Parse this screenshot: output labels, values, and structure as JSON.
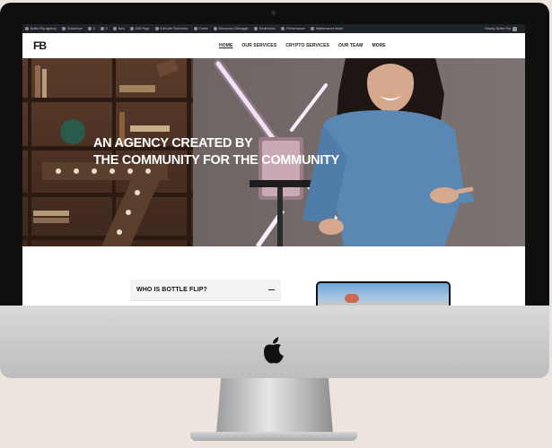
{
  "admin_bar": {
    "items": [
      "Bottle Flip Agency",
      "Customize",
      "6",
      "0",
      "New",
      "Edit Page",
      "Edit with Elementor",
      "Forms",
      "Elementor Debugger",
      "Redirection",
      "Performance",
      "Comments",
      "Maintenance Mode"
    ],
    "right": "Howdy, Bottle Flip"
  },
  "header": {
    "logo": "FB",
    "nav": [
      {
        "label": "HOME",
        "active": true
      },
      {
        "label": "OUR SERVICES",
        "active": false
      },
      {
        "label": "CRYPTO SERVICES",
        "active": false
      },
      {
        "label": "OUR TEAM",
        "active": false
      },
      {
        "label": "MORE",
        "active": false
      }
    ]
  },
  "hero": {
    "line1": "AN AGENCY CREATED BY",
    "line2": "THE COMMUNITY FOR THE COMMUNITY"
  },
  "faq": {
    "question": "WHO IS BOTTLE FLIP?"
  },
  "colors": {
    "admin_bar_bg": "#1d2327",
    "sweater_blue": "#5a87b4",
    "bezel": "#0f0f10"
  }
}
